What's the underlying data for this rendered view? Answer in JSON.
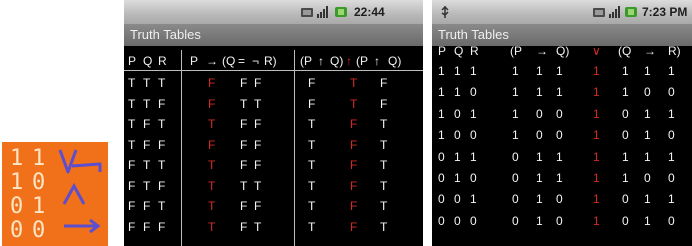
{
  "app_icon": {
    "digits": [
      [
        "1",
        "1"
      ],
      [
        "1",
        "0"
      ],
      [
        "0",
        "1"
      ],
      [
        "0",
        "0"
      ]
    ],
    "symbols": [
      "or-arrow-icon",
      "and-icon",
      "implies-arrow-icon"
    ],
    "colors": {
      "background": "#f1701a",
      "digits": "#fde6c6",
      "symbols": "#5b4fd0"
    }
  },
  "screen1": {
    "status": {
      "time": "22:44"
    },
    "title": "Truth Tables",
    "header": {
      "vars": [
        "P",
        "Q",
        "R"
      ],
      "expr1": [
        "P",
        "→",
        "(Q",
        "=",
        "¬",
        "R)"
      ],
      "expr2": [
        "(P",
        "↑",
        "Q)",
        "↑",
        "(P",
        "↑",
        "Q)"
      ]
    },
    "rows": [
      {
        "vars": [
          "T",
          "T",
          "T"
        ],
        "e1": [
          "F",
          "F",
          "F"
        ],
        "e2": [
          "F",
          "T",
          "F"
        ]
      },
      {
        "vars": [
          "T",
          "T",
          "F"
        ],
        "e1": [
          "F",
          "T",
          "T"
        ],
        "e2": [
          "F",
          "T",
          "F"
        ]
      },
      {
        "vars": [
          "T",
          "F",
          "T"
        ],
        "e1": [
          "T",
          "F",
          "F"
        ],
        "e2": [
          "T",
          "F",
          "T"
        ]
      },
      {
        "vars": [
          "T",
          "F",
          "F"
        ],
        "e1": [
          "F",
          "F",
          "F"
        ],
        "e2": [
          "T",
          "F",
          "T"
        ]
      },
      {
        "vars": [
          "F",
          "T",
          "T"
        ],
        "e1": [
          "T",
          "F",
          "F"
        ],
        "e2": [
          "T",
          "F",
          "T"
        ]
      },
      {
        "vars": [
          "F",
          "T",
          "F"
        ],
        "e1": [
          "T",
          "T",
          "T"
        ],
        "e2": [
          "T",
          "F",
          "T"
        ]
      },
      {
        "vars": [
          "F",
          "F",
          "T"
        ],
        "e1": [
          "T",
          "F",
          "F"
        ],
        "e2": [
          "T",
          "F",
          "T"
        ]
      },
      {
        "vars": [
          "F",
          "F",
          "F"
        ],
        "e1": [
          "T",
          "F",
          "T"
        ],
        "e2": [
          "T",
          "F",
          "T"
        ]
      }
    ]
  },
  "screen2": {
    "status": {
      "time": "7:23 PM"
    },
    "title": "Truth Tables",
    "header": {
      "vars": [
        "P",
        "Q",
        "R"
      ],
      "expr1": [
        "(P",
        "→",
        "Q)"
      ],
      "mid": "∨",
      "expr2": [
        "(Q",
        "→",
        "R)"
      ]
    },
    "rows": [
      {
        "vars": [
          "1",
          "1",
          "1"
        ],
        "e1": [
          "1",
          "1",
          "1"
        ],
        "mid": "1",
        "e2": [
          "1",
          "1",
          "1"
        ]
      },
      {
        "vars": [
          "1",
          "1",
          "0"
        ],
        "e1": [
          "1",
          "1",
          "1"
        ],
        "mid": "1",
        "e2": [
          "1",
          "0",
          "0"
        ]
      },
      {
        "vars": [
          "1",
          "0",
          "1"
        ],
        "e1": [
          "1",
          "0",
          "0"
        ],
        "mid": "1",
        "e2": [
          "0",
          "1",
          "1"
        ]
      },
      {
        "vars": [
          "1",
          "0",
          "0"
        ],
        "e1": [
          "1",
          "0",
          "0"
        ],
        "mid": "1",
        "e2": [
          "0",
          "1",
          "0"
        ]
      },
      {
        "vars": [
          "0",
          "1",
          "1"
        ],
        "e1": [
          "0",
          "1",
          "1"
        ],
        "mid": "1",
        "e2": [
          "1",
          "1",
          "1"
        ]
      },
      {
        "vars": [
          "0",
          "1",
          "0"
        ],
        "e1": [
          "0",
          "1",
          "1"
        ],
        "mid": "1",
        "e2": [
          "1",
          "0",
          "0"
        ]
      },
      {
        "vars": [
          "0",
          "0",
          "1"
        ],
        "e1": [
          "0",
          "1",
          "0"
        ],
        "mid": "1",
        "e2": [
          "0",
          "1",
          "1"
        ]
      },
      {
        "vars": [
          "0",
          "0",
          "0"
        ],
        "e1": [
          "0",
          "1",
          "0"
        ],
        "mid": "1",
        "e2": [
          "0",
          "1",
          "0"
        ]
      }
    ]
  },
  "colors": {
    "result": "#d22a25",
    "text": "#f4f4f4",
    "background": "#000000"
  }
}
